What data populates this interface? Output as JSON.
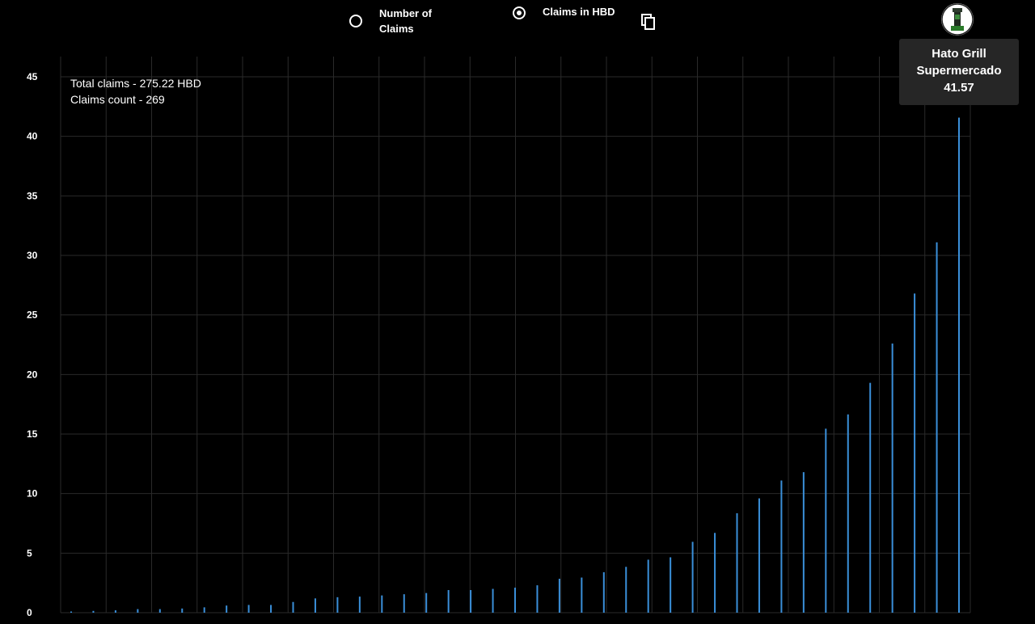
{
  "toolbar": {
    "option_count_label": "Number of Claims",
    "option_hbd_label": "Claims in HBD",
    "selected_option": "hbd"
  },
  "summary": {
    "total_claims": "Total claims - 275.22 HBD",
    "claims_count": "Claims count - 269"
  },
  "tooltip": {
    "name": "Hato Grill Supermercado",
    "value": "41.57"
  },
  "colors": {
    "background": "#000000",
    "bar": "#3a8fd9",
    "grid": "#2a2a2a",
    "tooltip_bg": "#262626"
  },
  "chart_data": {
    "type": "bar",
    "x": [
      1,
      2,
      3,
      4,
      5,
      6,
      7,
      8,
      9,
      10,
      11,
      12,
      13,
      14,
      15,
      16,
      17,
      18,
      19,
      20,
      21,
      22,
      23,
      24,
      25,
      26,
      27,
      28,
      29,
      30,
      31,
      32,
      33,
      34,
      35,
      36,
      37,
      38,
      39,
      40,
      41,
      42,
      43
    ],
    "values": [
      0.1,
      0.15,
      0.2,
      0.3,
      0.3,
      0.35,
      0.45,
      0.6,
      0.65,
      0.65,
      0.9,
      1.2,
      1.3,
      1.35,
      1.45,
      1.55,
      1.65,
      1.9,
      1.9,
      2.0,
      2.1,
      2.3,
      2.85,
      2.95,
      3.4,
      3.85,
      4.45,
      4.65,
      5.95,
      6.7,
      8.35,
      9.6,
      11.1,
      11.8,
      15.45,
      16.65,
      19.3,
      22.6,
      26.8,
      31.1,
      41.57
    ],
    "ylim": [
      0,
      45
    ],
    "yticks": [
      0,
      5,
      10,
      15,
      20,
      25,
      30,
      35,
      40,
      45
    ],
    "grid": true,
    "title": "",
    "xlabel": "",
    "ylabel": ""
  }
}
